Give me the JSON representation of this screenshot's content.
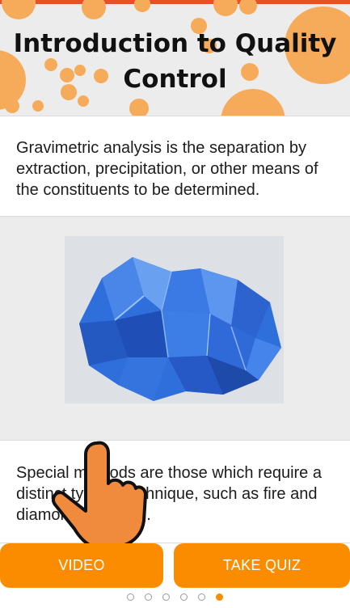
{
  "header": {
    "title": "Introduction to Quality Control"
  },
  "card1": {
    "text": "Gravimetric analysis is the separation by extraction, precipitation, or other means of the constituents to be determined."
  },
  "card2": {
    "text": "Special methods are those which require a distinct type of technique, such as fire and diamond assaying."
  },
  "image": {
    "subject": "blue crystal mineral"
  },
  "buttons": {
    "video": "VIDEO",
    "quiz": "TAKE QUIZ"
  },
  "pager": {
    "count": 6,
    "active_index": 5
  },
  "colors": {
    "accent": "#fb8c00",
    "header_bg": "#ececec",
    "decor": "#f6ab5b",
    "crystal": "#2f6fdc"
  }
}
